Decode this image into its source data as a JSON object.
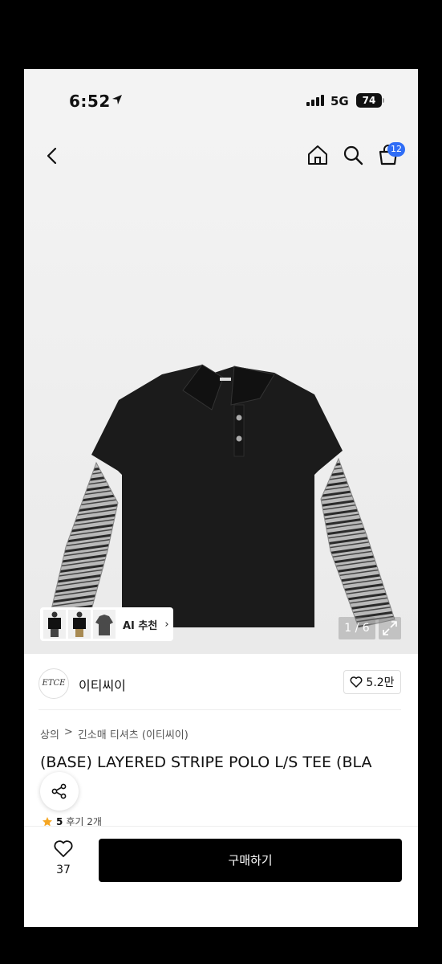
{
  "status_bar": {
    "time": "6:52",
    "network": "5G",
    "battery": "74"
  },
  "header": {
    "cart_count": "12"
  },
  "gallery": {
    "ai_label": "AI 추천",
    "page_indicator": "1 / 6"
  },
  "seller": {
    "logo_text": "ETCE",
    "name": "이티씨이",
    "likes": "5.2만"
  },
  "breadcrumb": {
    "category": "상의",
    "separator": ">",
    "subcategory": "긴소매 티셔츠 (이티씨이)"
  },
  "product": {
    "title": "(BASE) LAYERED STRIPE POLO L/S TEE (BLA"
  },
  "rating": {
    "score": "5",
    "reviews": "후기 2개"
  },
  "bottom_bar": {
    "wish_count": "37",
    "buy_label": "구매하기"
  },
  "colors": {
    "accent": "#2f6df6",
    "buy_button": "#000000",
    "star": "#f5a623"
  }
}
